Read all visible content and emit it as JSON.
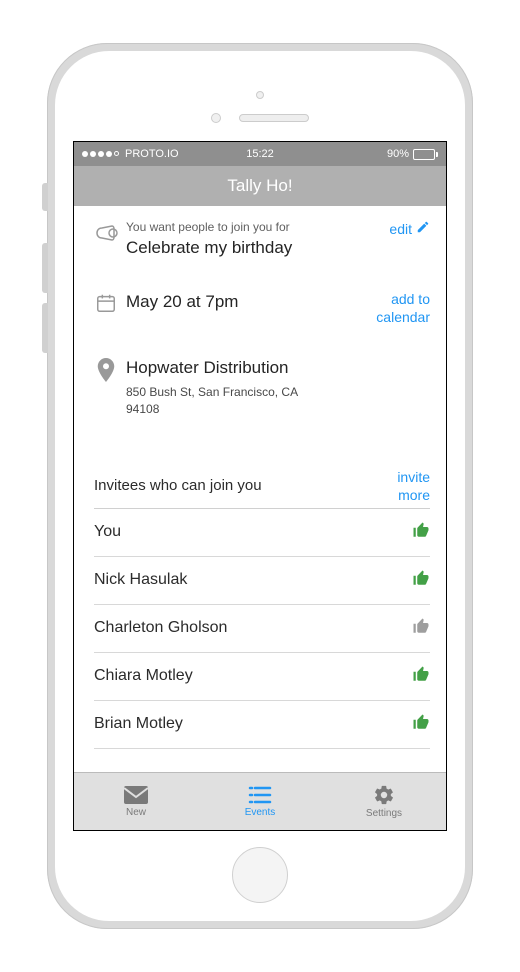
{
  "status_bar": {
    "carrier": "PROTO.IO",
    "time": "15:22",
    "battery_percent": "90%"
  },
  "title_bar": {
    "title": "Tally Ho!"
  },
  "event": {
    "prompt_sublabel": "You want people to join you for",
    "prompt_value": "Celebrate my birthday",
    "edit_label": "edit",
    "datetime": "May 20 at 7pm",
    "add_to_calendar_line1": "add to",
    "add_to_calendar_line2": "calendar",
    "location_name": "Hopwater Distribution",
    "location_address": "850 Bush St, San Francisco, CA 94108"
  },
  "invitees_section": {
    "title": "Invitees who can join you",
    "invite_more_line1": "invite",
    "invite_more_line2": "more",
    "list": [
      {
        "name": "You",
        "status": "confirmed"
      },
      {
        "name": "Nick Hasulak",
        "status": "confirmed"
      },
      {
        "name": "Charleton Gholson",
        "status": "maybe"
      },
      {
        "name": "Chiara Motley",
        "status": "confirmed"
      },
      {
        "name": "Brian Motley",
        "status": "confirmed"
      }
    ]
  },
  "tab_bar": {
    "new": "New",
    "events": "Events",
    "settings": "Settings"
  }
}
